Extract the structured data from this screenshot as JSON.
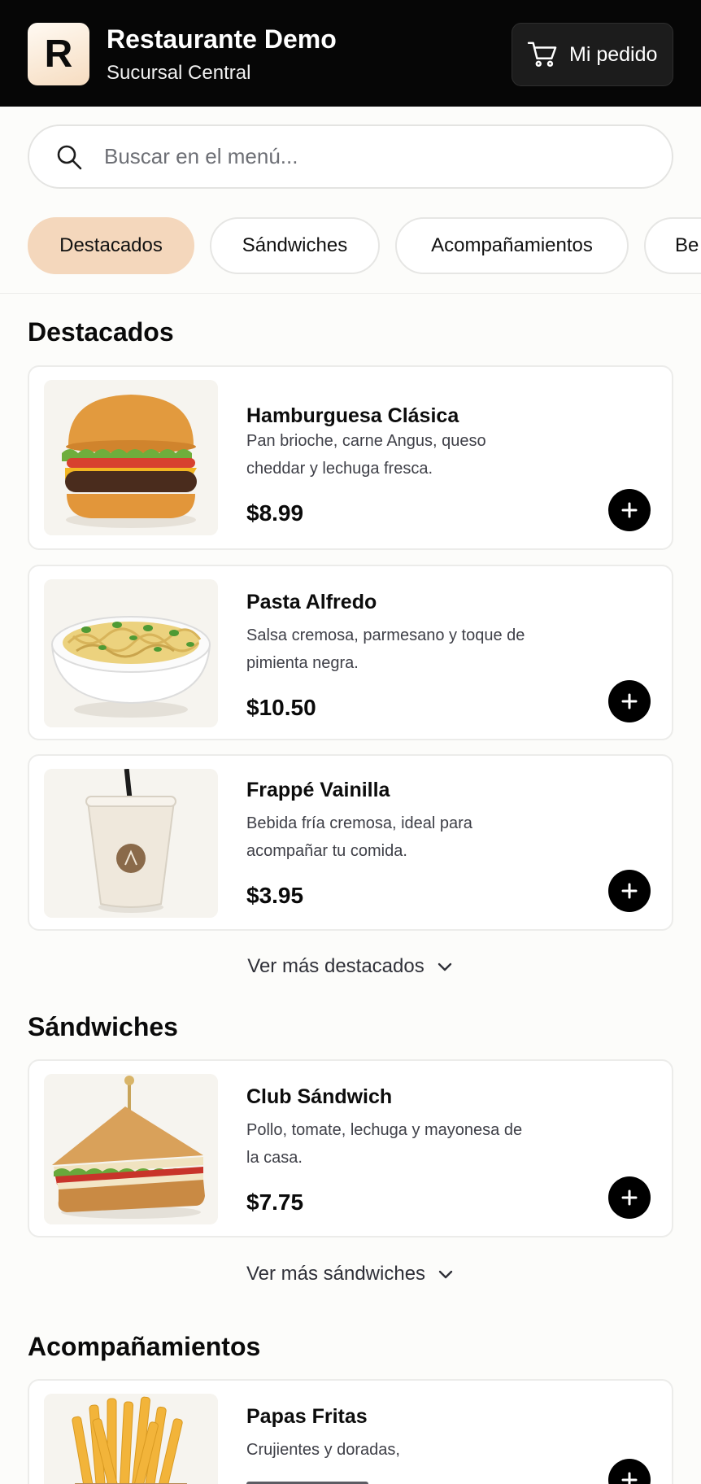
{
  "header": {
    "logo_letter": "R",
    "restaurant_name": "Restaurante Demo",
    "branch": "Sucursal Central",
    "order_button": {
      "label": "Mi pedido",
      "icon": "cart-icon"
    }
  },
  "search": {
    "placeholder": "Buscar en el menú...",
    "value": "",
    "icon": "search-icon"
  },
  "categories": [
    {
      "label": "Destacados",
      "active": true
    },
    {
      "label": "Sándwiches",
      "active": false
    },
    {
      "label": "Acompañamientos",
      "active": false
    },
    {
      "label": "Be",
      "active": false
    }
  ],
  "sections": [
    {
      "title": "Destacados",
      "items": [
        {
          "name": "Hamburguesa Clásica",
          "description": "Pan brioche, carne Angus, queso cheddar y lechuga fresca.",
          "price": "$8.99",
          "image": "burger"
        },
        {
          "name": "Pasta Alfredo",
          "description": "Salsa cremosa, parmesano y toque de pimienta negra.",
          "price": "$10.50",
          "image": "pasta"
        },
        {
          "name": "Frappé Vainilla",
          "description": "Bebida fría cremosa, ideal para acompañar tu comida.",
          "price": "$3.95",
          "image": "frappe"
        }
      ],
      "more_label": "Ver más destacados"
    },
    {
      "title": "Sándwiches",
      "items": [
        {
          "name": "Club Sándwich",
          "description": "Pollo, tomate, lechuga y mayonesa de la casa.",
          "price": "$7.75",
          "image": "sandwich"
        }
      ],
      "more_label": "Ver más sándwiches"
    },
    {
      "title": "Acompañamientos",
      "items": [
        {
          "name": "Papas Fritas",
          "description": "Crujientes y doradas,",
          "price": "",
          "image": "fries"
        }
      ]
    }
  ],
  "colors": {
    "header_bg": "#060606",
    "active_tab": "#f4d7bc",
    "add_button": "#000000"
  }
}
